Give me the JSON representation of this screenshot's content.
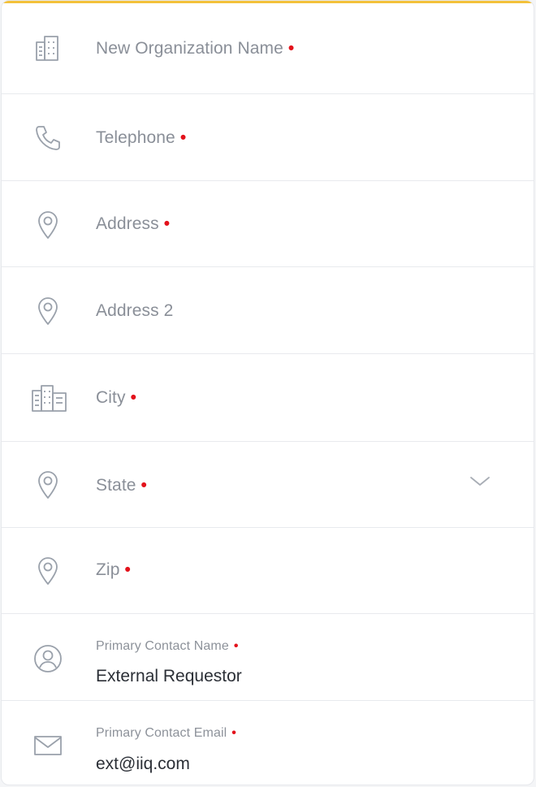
{
  "form": {
    "fields": [
      {
        "label": "New Organization Name",
        "required_mark": "•",
        "icon": "office-building-icon"
      },
      {
        "label": "Telephone",
        "required_mark": "•",
        "icon": "phone-icon"
      },
      {
        "label": "Address",
        "required_mark": "•",
        "icon": "map-pin-icon"
      },
      {
        "label": "Address 2",
        "required_mark": "",
        "icon": "map-pin-icon"
      },
      {
        "label": "City",
        "required_mark": "•",
        "icon": "city-buildings-icon"
      },
      {
        "label": "State",
        "required_mark": "•",
        "icon": "map-pin-icon",
        "dropdown_icon": "chevron-down-icon"
      },
      {
        "label": "Zip",
        "required_mark": "•",
        "icon": "map-pin-icon"
      },
      {
        "label": "Primary Contact Name",
        "required_mark": "•",
        "icon": "user-circle-icon",
        "value": "External Requestor"
      },
      {
        "label": "Primary Contact Email",
        "required_mark": "•",
        "icon": "envelope-icon",
        "value": "ext@iiq.com"
      }
    ]
  },
  "colors": {
    "accent_top_border": "#f3c13a",
    "required": "#e3121b",
    "label": "#8a8f98",
    "value": "#2b2f36",
    "icon": "#9aa1ab"
  }
}
